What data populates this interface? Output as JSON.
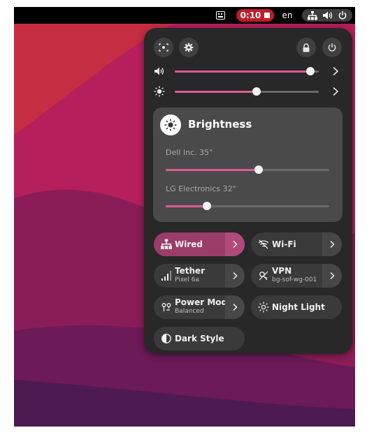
{
  "topbar": {
    "keyboard_icon": "keyboard-icon",
    "recording_time": "0:10",
    "language": "en",
    "status_icons": [
      "network-wired-icon",
      "volume-icon",
      "power-icon"
    ]
  },
  "colors": {
    "accent": "#e15b8c",
    "tile_active": "#9a3d68",
    "panel_bg": "#282828",
    "recording_red": "#c01c28"
  },
  "quick_settings": {
    "header_buttons": [
      "screenshot-icon",
      "settings-icon",
      "lock-icon",
      "power-icon"
    ],
    "volume": {
      "icon": "volume-icon",
      "level": 0.94
    },
    "brightness": {
      "icon": "brightness-icon",
      "level": 0.57
    },
    "brightness_menu": {
      "title": "Brightness",
      "displays": [
        {
          "name": "Dell Inc. 35\"",
          "level": 0.57
        },
        {
          "name": "LG Electronics 32\"",
          "level": 0.25
        }
      ]
    },
    "tiles": [
      {
        "label": "Wired",
        "subtitle": "",
        "icon": "network-wired-icon",
        "active": true,
        "has_menu": true
      },
      {
        "label": "Wi-Fi",
        "subtitle": "",
        "icon": "wifi-off-icon",
        "active": false,
        "has_menu": true
      },
      {
        "label": "Tether",
        "subtitle": "Pixel 6a",
        "icon": "cellular-icon",
        "active": false,
        "has_menu": true
      },
      {
        "label": "VPN",
        "subtitle": "bg-sof-wg-001",
        "icon": "vpn-off-icon",
        "active": false,
        "has_menu": true
      },
      {
        "label": "Power Mode",
        "subtitle": "Balanced",
        "icon": "power-profile-icon",
        "active": false,
        "has_menu": true
      },
      {
        "label": "Night Light",
        "subtitle": "",
        "icon": "night-light-icon",
        "active": false,
        "has_menu": false
      },
      {
        "label": "Dark Style",
        "subtitle": "",
        "icon": "dark-style-icon",
        "active": false,
        "has_menu": false
      }
    ]
  }
}
